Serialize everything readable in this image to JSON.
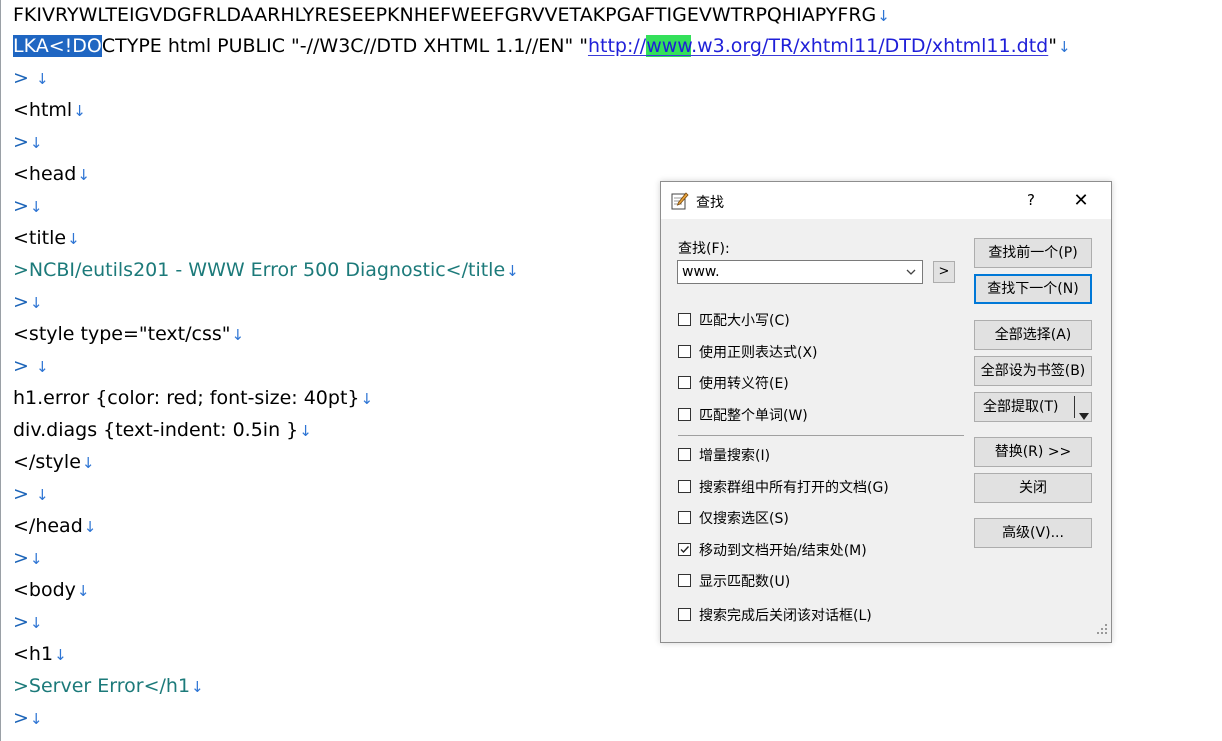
{
  "editor": {
    "line1": "FKIVRYWLTEIGVDGFRLDAARHLYRESEEPKNHEFWEEFGRVVETAKPGAFTIGEVWTRPQHIAPYFRG",
    "line2": {
      "selected": "LKA<!DO",
      "rest": "CTYPE html PUBLIC \"-//W3C//DTD XHTML 1.1//EN\" \"",
      "url_before": "http://",
      "url_match": "www",
      "url_after": ".w3.org/TR/xhtml11/DTD/xhtml11.dtd",
      "close_quote": "\""
    },
    "line3": "> ",
    "line4": "<html",
    "line5": ">",
    "line6": "<head",
    "line7": ">",
    "line8": "<title",
    "line9": ">NCBI/eutils201 - WWW Error 500 Diagnostic</title",
    "line10": ">",
    "line11": "<style type=\"text/css\"",
    "line12": "> ",
    "line13": "h1.error {color: red; font-size: 40pt}",
    "line14": "div.diags {text-indent: 0.5in }",
    "line15": "</style",
    "line16": "> ",
    "line17": "</head",
    "line18": ">",
    "line19": "<body",
    "line20": ">",
    "line21": "<h1",
    "line22": ">Server Error</h1",
    "line23": ">",
    "eol_mark": "↓"
  },
  "dialog": {
    "title": "查找",
    "help": "?",
    "close": "✕",
    "find_label": "查找(F):",
    "find_value": "www.",
    "arrow_label": ">",
    "options": [
      {
        "label": "匹配大小写(C)",
        "checked": false
      },
      {
        "label": "使用正则表达式(X)",
        "checked": false
      },
      {
        "label": "使用转义符(E)",
        "checked": false
      },
      {
        "label": "匹配整个单词(W)",
        "checked": false
      },
      {
        "label": "增量搜索(I)",
        "checked": false
      },
      {
        "label": "搜索群组中所有打开的文档(G)",
        "checked": false
      },
      {
        "label": "仅搜索选区(S)",
        "checked": false
      },
      {
        "label": "移动到文档开始/结束处(M)",
        "checked": true
      },
      {
        "label": "显示匹配数(U)",
        "checked": false
      },
      {
        "label": "搜索完成后关闭该对话框(L)",
        "checked": false
      }
    ],
    "buttons": {
      "find_prev": "查找前一个(P)",
      "find_next": "查找下一个(N)",
      "select_all": "全部选择(A)",
      "bookmark_all": "全部设为书签(B)",
      "extract_all": "全部提取(T)",
      "replace": "替换(R) >>",
      "close": "关闭",
      "advanced": "高级(V)..."
    }
  }
}
